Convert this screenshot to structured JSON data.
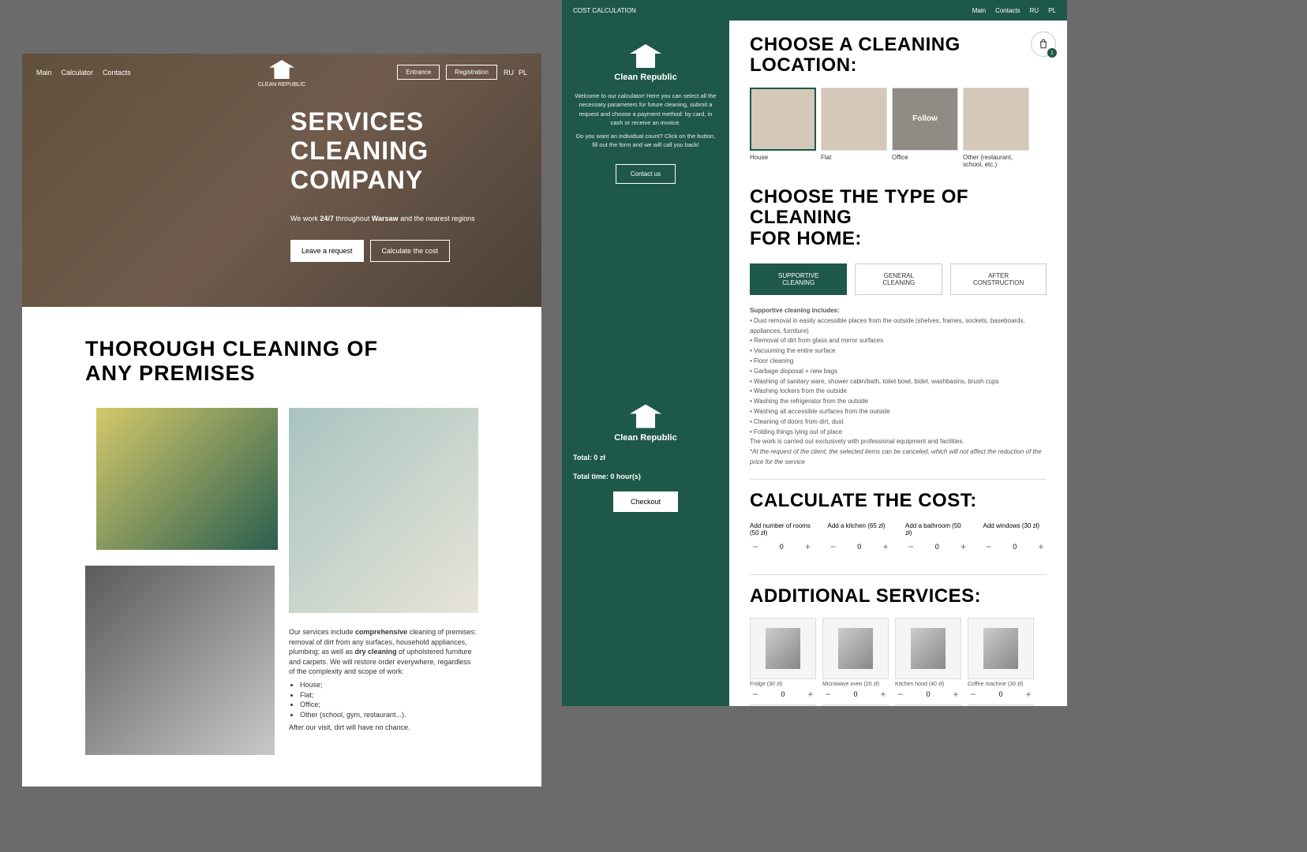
{
  "left": {
    "nav": {
      "main": "Main",
      "calculator": "Calculator",
      "contacts": "Contacts",
      "entrance": "Entrance",
      "registration": "Registration",
      "ru": "RU",
      "pl": "PL",
      "brand": "CLEAN REPUBLIC"
    },
    "hero": {
      "title_l1": "SERVICES",
      "title_l2": "CLEANING",
      "title_l3": "COMPANY",
      "sub_pre": "We work ",
      "sub_b": "24/7",
      "sub_mid": " throughout ",
      "sub_loc": "Warsaw",
      "sub_post": " and the nearest regions",
      "cta1": "Leave a request",
      "cta2": "Calculate the cost"
    },
    "s2": {
      "title_l1": "THOROUGH CLEANING OF",
      "title_l2": "ANY PREMISES",
      "p1_pre": "Our services include ",
      "p1_b1": "comprehensive",
      "p1_mid": " cleaning of premises: removal of dirt from any surfaces, household appliances, plumbing; as well as ",
      "p1_b2": "dry cleaning",
      "p1_post": " of upholstered furniture and carpets. We will restore order everywhere, regardless of the complexity and scope of work:",
      "li1": "House;",
      "li2": "Flat;",
      "li3": "Office;",
      "li4": "Other (school, gym, restaurant...).",
      "p2": "After our visit, dirt will have no chance."
    }
  },
  "right": {
    "topbar": {
      "title": "COST CALCULATION",
      "main": "Main",
      "contacts": "Contacts",
      "ru": "RU",
      "pl": "PL"
    },
    "sidebar": {
      "brand": "Clean Republic",
      "welcome": "Welcome to our calculator! Here you can select all the necessary parameters for future cleaning, submit a request and choose a payment method: by card, in cash or receive an invoice.",
      "welcome2": "Do you want an individual count? Click on the button, fill out the form and we will call you back!",
      "contact": "Contact us",
      "total": "Total: 0 zł",
      "time": "Total time: 0 hour(s)",
      "checkout": "Checkout"
    },
    "cart": {
      "count": "1"
    },
    "h_location": "CHOOSE A CLEANING LOCATION:",
    "locations": [
      {
        "label": "House"
      },
      {
        "label": "Flat"
      },
      {
        "label": "Office",
        "overlay": "Follow"
      },
      {
        "label": "Other (restaurant, school, etc.)"
      }
    ],
    "h_type_l1": "CHOOSE THE TYPE OF CLEANING",
    "h_type_l2": "FOR HOME:",
    "tabs": {
      "t1": "SUPPORTIVE CLEANING",
      "t2": "GENERAL CLEANING",
      "t3": "AFTER CONSTRUCTION"
    },
    "desc": {
      "head": "Supportive cleaning includes:",
      "items": [
        "• Dust removal in easily accessible places from the outside (shelves, frames, sockets, baseboards, appliances, furniture)",
        "• Removal of dirt from glass and mirror surfaces",
        "• Vacuuming the entire surface",
        "• Floor cleaning",
        "• Garbage disposal + new bags",
        "• Washing of sanitary ware, shower cabin/bath, toilet bowl, bidet, washbasins, brush cups",
        "• Washing lockers from the outside",
        "• Washing the refrigerator from the outside",
        "• Washing all accessible surfaces from the outside",
        "• Cleaning of doors from dirt, dust",
        "• Folding things lying out of place"
      ],
      "note": "The work is carried out exclusively with professional equipment and facilities.",
      "disclaimer": "*At the request of the client, the selected items can be canceled, which will not affect the reduction of the price for the service"
    },
    "h_calc": "CALCULATE THE COST:",
    "counters": [
      {
        "label": "Add number of rooms (50 zł)",
        "val": "0"
      },
      {
        "label": "Add a kitchen (65 zł)",
        "val": "0"
      },
      {
        "label": "Add a bathroom (50 zł)",
        "val": "0"
      },
      {
        "label": "Add windows (30 zł)",
        "val": "0"
      }
    ],
    "h_services": "ADDITIONAL SERVICES:",
    "services": [
      {
        "label": "Fridge (30 zł)",
        "val": "0"
      },
      {
        "label": "Microwave oven (20 zł)",
        "val": "0"
      },
      {
        "label": "Kitchen hood (40 zł)",
        "val": "0"
      },
      {
        "label": "Coffee machine (30 zł)",
        "val": "0"
      }
    ]
  }
}
